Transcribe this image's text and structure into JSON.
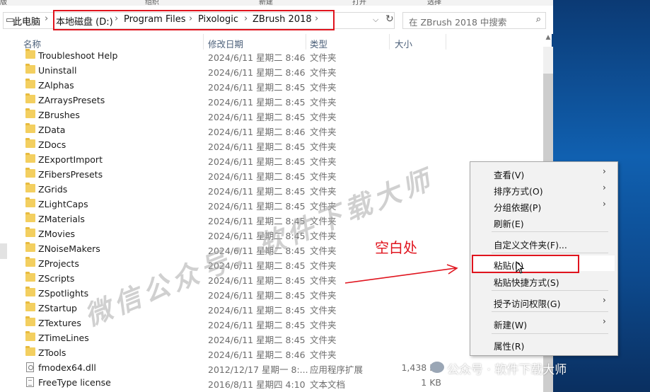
{
  "ribbon": {
    "items": [
      "版",
      "组织",
      "新建",
      "打开",
      "选择"
    ]
  },
  "address": {
    "breadcrumbs": [
      "此电脑",
      "本地磁盘 (D:)",
      "Program Files",
      "Pixologic",
      "ZBrush 2018"
    ]
  },
  "search": {
    "placeholder": "在 ZBrush 2018 中搜索"
  },
  "columns": {
    "name": "名称",
    "date": "修改日期",
    "type": "类型",
    "size": "大小"
  },
  "files": [
    {
      "name": "Troubleshoot Help",
      "date": "2024/6/11 星期二 8:46",
      "type": "文件夹",
      "size": "",
      "icon": "folder"
    },
    {
      "name": "Uninstall",
      "date": "2024/6/11 星期二 8:46",
      "type": "文件夹",
      "size": "",
      "icon": "folder"
    },
    {
      "name": "ZAlphas",
      "date": "2024/6/11 星期二 8:45",
      "type": "文件夹",
      "size": "",
      "icon": "folder"
    },
    {
      "name": "ZArraysPresets",
      "date": "2024/6/11 星期二 8:45",
      "type": "文件夹",
      "size": "",
      "icon": "folder"
    },
    {
      "name": "ZBrushes",
      "date": "2024/6/11 星期二 8:45",
      "type": "文件夹",
      "size": "",
      "icon": "folder"
    },
    {
      "name": "ZData",
      "date": "2024/6/11 星期二 8:46",
      "type": "文件夹",
      "size": "",
      "icon": "folder"
    },
    {
      "name": "ZDocs",
      "date": "2024/6/11 星期二 8:45",
      "type": "文件夹",
      "size": "",
      "icon": "folder"
    },
    {
      "name": "ZExportImport",
      "date": "2024/6/11 星期二 8:45",
      "type": "文件夹",
      "size": "",
      "icon": "folder"
    },
    {
      "name": "ZFibersPresets",
      "date": "2024/6/11 星期二 8:45",
      "type": "文件夹",
      "size": "",
      "icon": "folder"
    },
    {
      "name": "ZGrids",
      "date": "2024/6/11 星期二 8:45",
      "type": "文件夹",
      "size": "",
      "icon": "folder"
    },
    {
      "name": "ZLightCaps",
      "date": "2024/6/11 星期二 8:45",
      "type": "文件夹",
      "size": "",
      "icon": "folder"
    },
    {
      "name": "ZMaterials",
      "date": "2024/6/11 星期二 8:45",
      "type": "文件夹",
      "size": "",
      "icon": "folder"
    },
    {
      "name": "ZMovies",
      "date": "2024/6/11 星期二 8:45",
      "type": "文件夹",
      "size": "",
      "icon": "folder"
    },
    {
      "name": "ZNoiseMakers",
      "date": "2024/6/11 星期二 8:45",
      "type": "文件夹",
      "size": "",
      "icon": "folder"
    },
    {
      "name": "ZProjects",
      "date": "2024/6/11 星期二 8:45",
      "type": "文件夹",
      "size": "",
      "icon": "folder"
    },
    {
      "name": "ZScripts",
      "date": "2024/6/11 星期二 8:45",
      "type": "文件夹",
      "size": "",
      "icon": "folder"
    },
    {
      "name": "ZSpotlights",
      "date": "2024/6/11 星期二 8:45",
      "type": "文件夹",
      "size": "",
      "icon": "folder"
    },
    {
      "name": "ZStartup",
      "date": "2024/6/11 星期二 8:45",
      "type": "文件夹",
      "size": "",
      "icon": "folder"
    },
    {
      "name": "ZTextures",
      "date": "2024/6/11 星期二 8:45",
      "type": "文件夹",
      "size": "",
      "icon": "folder"
    },
    {
      "name": "ZTimeLines",
      "date": "2024/6/11 星期二 8:45",
      "type": "文件夹",
      "size": "",
      "icon": "folder"
    },
    {
      "name": "ZTools",
      "date": "2024/6/11 星期二 8:46",
      "type": "文件夹",
      "size": "",
      "icon": "folder"
    },
    {
      "name": "fmodex64.dll",
      "date": "2012/12/17 星期一 8:...",
      "type": "应用程序扩展",
      "size": "1,438 KB",
      "icon": "dll"
    },
    {
      "name": "FreeType license",
      "date": "2016/8/11 星期四 4:10",
      "type": "文本文档",
      "size": "1 KB",
      "icon": "txt"
    }
  ],
  "context_menu": {
    "items": [
      {
        "label": "查看(V)",
        "submenu": true
      },
      {
        "label": "排序方式(O)",
        "submenu": true
      },
      {
        "label": "分组依据(P)",
        "submenu": true
      },
      {
        "label": "刷新(E)",
        "submenu": false
      },
      {
        "label": "自定义文件夹(F)...",
        "submenu": false
      },
      {
        "label": "粘贴(P)",
        "submenu": false
      },
      {
        "label": "粘贴快捷方式(S)",
        "submenu": false
      },
      {
        "label": "授予访问权限(G)",
        "submenu": true
      },
      {
        "label": "新建(W)",
        "submenu": true
      },
      {
        "label": "属性(R)",
        "submenu": false
      }
    ]
  },
  "annotation": {
    "label": "空白处"
  },
  "watermark": {
    "text": "微信公众号：软件下载大师"
  },
  "credit": {
    "text": "公众号 · 软件下载大师"
  },
  "colors": {
    "highlight_box": "#e0141e",
    "folder": "#f3cf60",
    "header_text": "#4c607a"
  }
}
